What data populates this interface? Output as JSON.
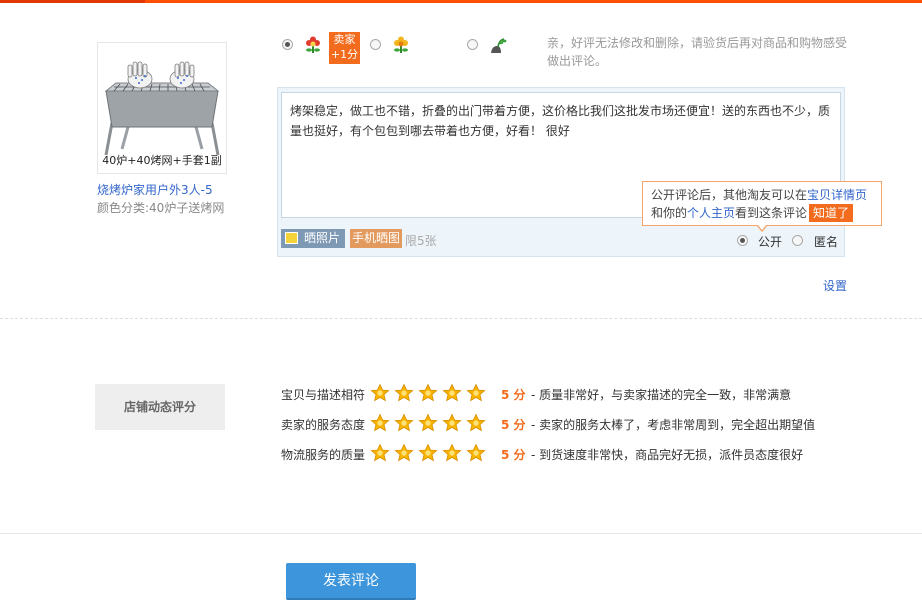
{
  "product": {
    "image_caption": "40炉+40烤网+手套1副",
    "name": "烧烤炉家用户外3人-5",
    "spec": "颜色分类:40炉子送烤网"
  },
  "rating": {
    "options": [
      {
        "name": "good",
        "icon": "red-flower-icon",
        "checked": true
      },
      {
        "name": "neutral",
        "icon": "yellow-flower-icon",
        "checked": false
      },
      {
        "name": "bad",
        "icon": "wilted-plant-icon",
        "checked": false
      }
    ],
    "seller_badge_line1": "卖家",
    "seller_badge_line2": "+1分",
    "note": "亲，好评无法修改和删除，请验货后再对商品和购物感受做出评论。"
  },
  "editor": {
    "text": "烤架稳定，做工也不错，折叠的出门带着方便，这价格比我们这批发市场还便宜！送的东西也不少，质量也挺好，有个包包到哪去带着也方便，好看！  很好",
    "photo_button": "晒照片",
    "mobile_photo_button": "手机晒图",
    "limit": "限5张",
    "public_label": "公开",
    "anonymous_label": "匿名",
    "visibility": "公开"
  },
  "tooltip": {
    "part1": "公开评论后，其他淘友可以在",
    "link1": "宝贝详情页",
    "part2": "和你的",
    "link2": "个人主页",
    "part3": "看到这条评论",
    "ok": "知道了"
  },
  "settings_link": "设置",
  "shop_rating": {
    "title": "店铺动态评分",
    "rows": [
      {
        "label": "宝贝与描述相符",
        "stars": 5,
        "score": "5 分",
        "desc": "- 质量非常好，与卖家描述的完全一致，非常满意"
      },
      {
        "label": "卖家的服务态度",
        "stars": 5,
        "score": "5 分",
        "desc": "- 卖家的服务太棒了，考虑非常周到，完全超出期望值"
      },
      {
        "label": "物流服务的质量",
        "stars": 5,
        "score": "5 分",
        "desc": "- 到货速度非常快，商品完好无损，派件员态度很好"
      }
    ]
  },
  "submit_label": "发表评论",
  "colors": {
    "accent": "#ff5000",
    "link": "#3366cc",
    "score": "#f36b1c",
    "button": "#3d95dc"
  }
}
